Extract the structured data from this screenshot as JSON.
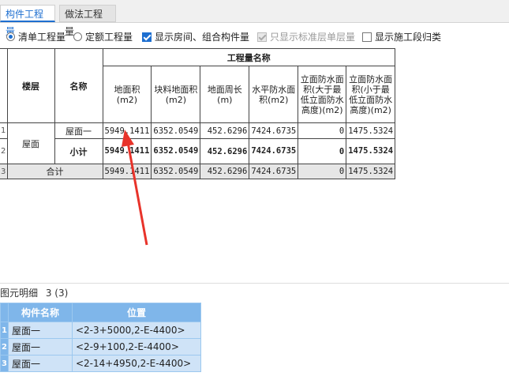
{
  "tabs": [
    "构件工程量",
    "做法工程量"
  ],
  "options": {
    "radio_qingdan": "清单工程量",
    "radio_dinge": "定额工程量",
    "cb_show_rooms": "显示房间、组合构件量",
    "cb_std_floor": "只显示标准层单层量",
    "cb_segment": "显示施工段归类"
  },
  "grid": {
    "group_header": "工程量名称",
    "col_floor": "楼层",
    "col_name": "名称",
    "columns": [
      "地面积(m2)",
      "块料地面积(m2)",
      "地面周长(m)",
      "水平防水面积(m2)",
      "立面防水面积(大于最低立面防水高度)(m2)",
      "立面防水面积(小于最低立面防水高度)(m2)"
    ],
    "row_numbers": [
      "1",
      "2",
      "3"
    ],
    "floor": "屋面",
    "rows": [
      {
        "name": "屋面一",
        "values": [
          "5949.1411",
          "6352.0549",
          "452.6296",
          "7424.6735",
          "0",
          "1475.5324"
        ]
      },
      {
        "name": "小计",
        "values": [
          "5949.1411",
          "6352.0549",
          "452.6296",
          "7424.6735",
          "0",
          "1475.5324"
        ]
      },
      {
        "name": "合计",
        "values": [
          "5949.1411",
          "6352.0549",
          "452.6296",
          "7424.6735",
          "0",
          "1475.5324"
        ]
      }
    ]
  },
  "detail": {
    "title": "图元明细",
    "count": "3 (3)",
    "headers": [
      "构件名称",
      "位置"
    ],
    "row_numbers": [
      "1",
      "2",
      "3"
    ],
    "rows": [
      {
        "name": "屋面一",
        "pos": "<2-3+5000,2-E-4400>"
      },
      {
        "name": "屋面一",
        "pos": "<2-9+100,2-E-4400>"
      },
      {
        "name": "屋面一",
        "pos": "<2-14+4950,2-E-4400>"
      }
    ]
  },
  "colors": {
    "accent": "#1e6fd0",
    "arrow": "#e8332a",
    "detail_header": "#7fb6ea",
    "detail_row": "#cfe3f7"
  }
}
